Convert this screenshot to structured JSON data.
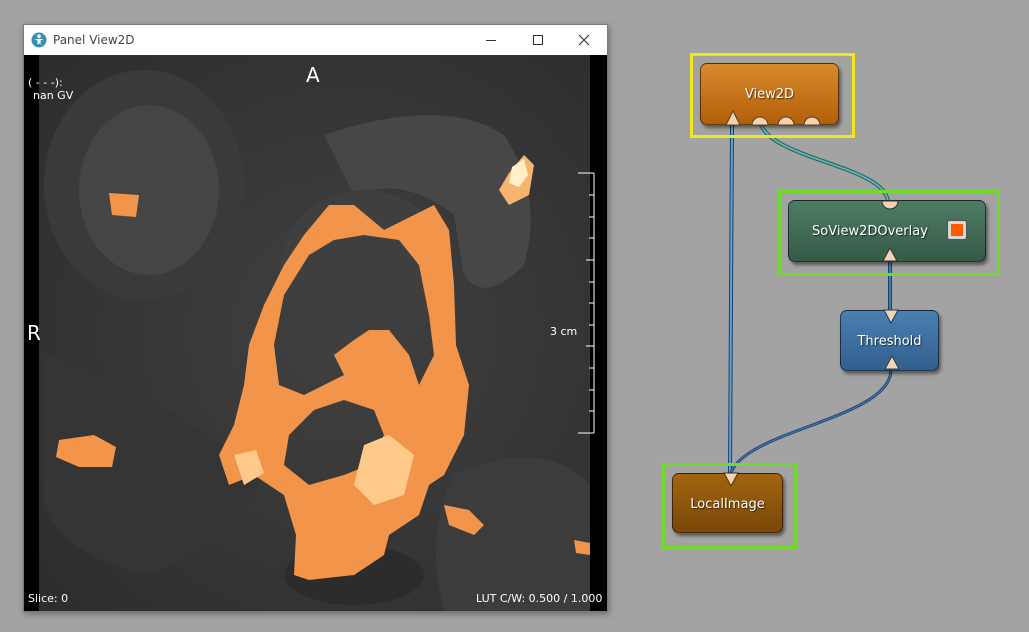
{
  "window": {
    "title": "Panel View2D"
  },
  "viewer": {
    "orientation_top": "A",
    "orientation_left": "R",
    "info_line1": "( - - -):",
    "info_line2": "nan GV",
    "scale_label": "3 cm",
    "slice": "Slice: 0",
    "lut": "LUT C/W: 0.500 / 1.000"
  },
  "network": {
    "nodes": {
      "view2d": {
        "label": "View2D",
        "color": "#c06c10"
      },
      "overlay": {
        "label": "SoView2DOverlay",
        "color": "#3f6b55"
      },
      "threshold": {
        "label": "Threshold",
        "color": "#3b6b9a"
      },
      "localimage": {
        "label": "LocalImage",
        "color": "#8a520c"
      }
    },
    "selection_colors": {
      "view2d": "#f2e61e",
      "others": "#6fdc2c"
    },
    "connection_colors": {
      "image": "#3d7fb0",
      "inventor": "#4a9a9a"
    }
  }
}
